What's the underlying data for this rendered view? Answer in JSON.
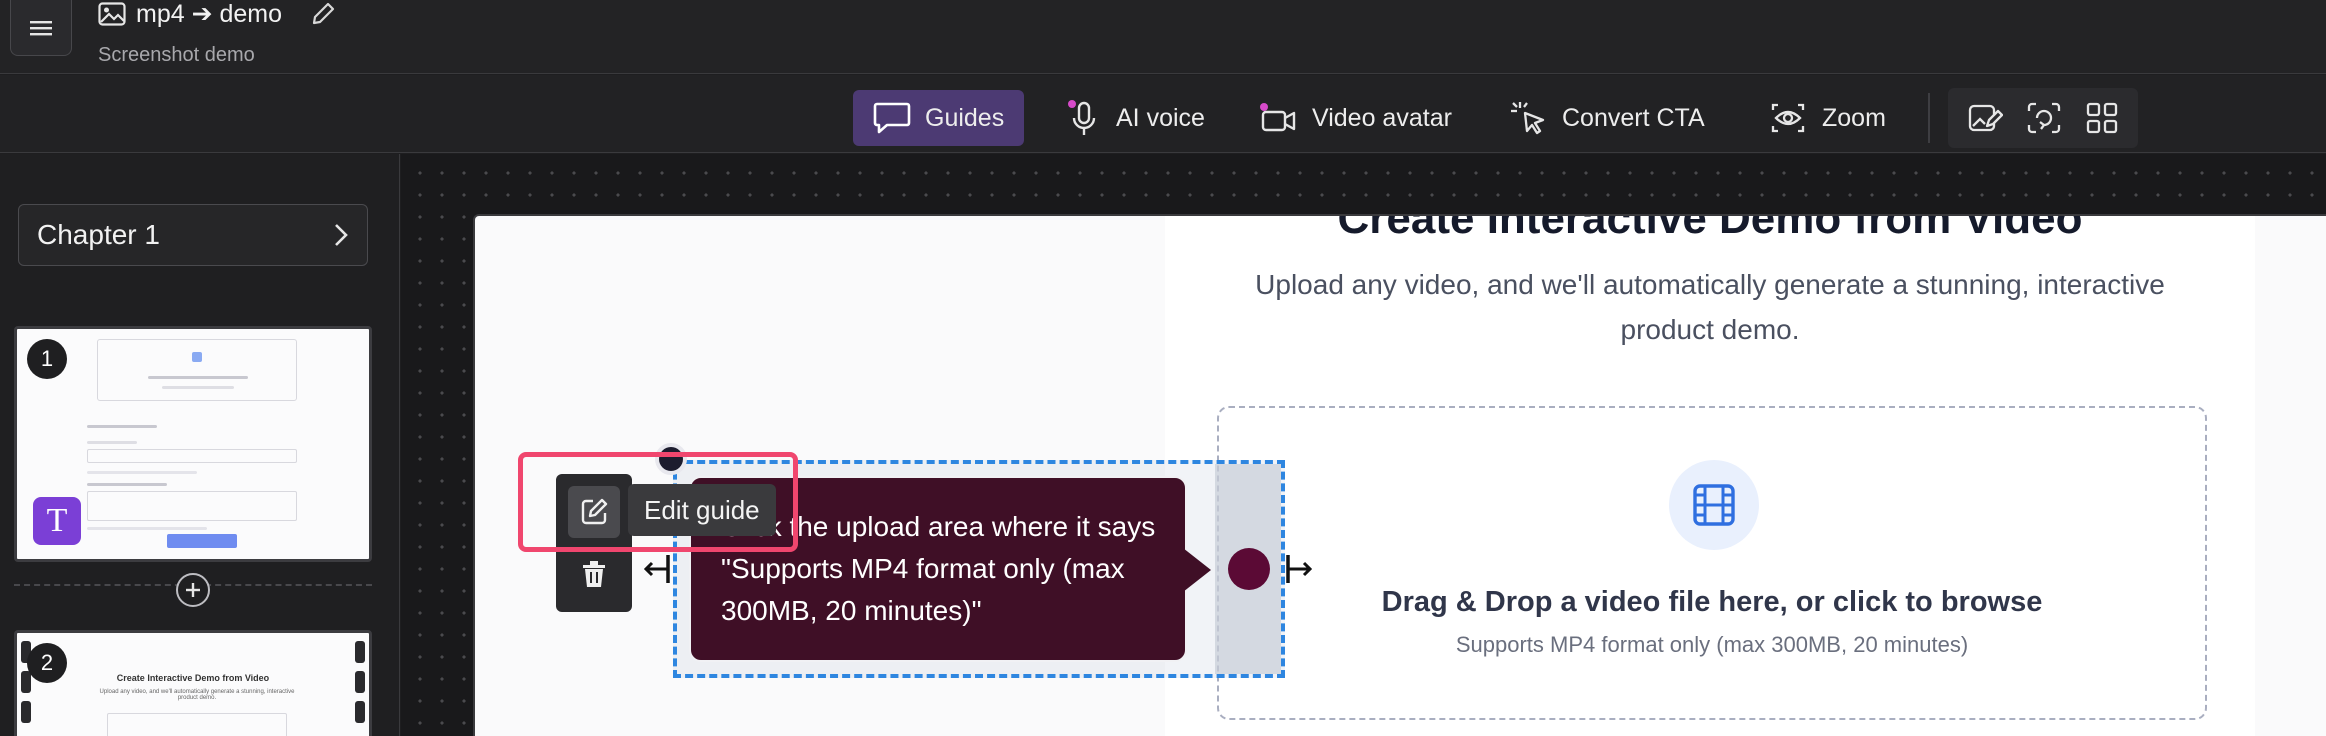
{
  "header": {
    "title": "mp4 ➔ demo",
    "subtitle": "Screenshot demo"
  },
  "toolbar": {
    "guides": "Guides",
    "ai_voice": "AI voice",
    "video_avatar": "Video avatar",
    "convert_cta": "Convert CTA",
    "zoom": "Zoom"
  },
  "sidebar": {
    "chapter": "Chapter 1",
    "slides": [
      {
        "number": "1"
      },
      {
        "number": "2",
        "title": "Create Interactive Demo from Video",
        "subtitle": "Upload any video, and we'll automatically generate a stunning, interactive product demo."
      }
    ],
    "avatar_letter": "T"
  },
  "page": {
    "hero_title": "Create Interactive Demo from Video",
    "hero_subtitle": "Upload any video, and we'll automatically generate a stunning, interactive product demo.",
    "dropzone_title": "Drag & Drop a video file here, or click to browse",
    "dropzone_subtitle": "Supports MP4 format only (max 300MB, 20 minutes)"
  },
  "guide": {
    "tooltip_text": "Click the upload area where it says \"Supports MP4 format only (max 300MB, 20 minutes)\"",
    "edit_tooltip": "Edit guide"
  },
  "colors": {
    "accent": "#4c3a73",
    "tooltip_bg": "#3f0f26",
    "selection": "#2e86e0",
    "highlight": "#f0466e"
  }
}
